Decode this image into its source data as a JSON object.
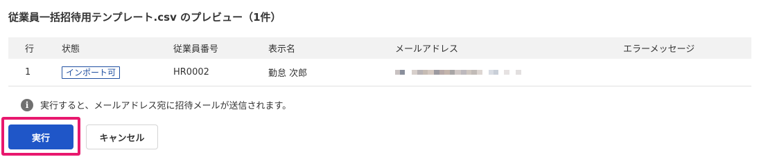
{
  "dialog": {
    "title": "従業員一括招待用テンプレート.csv のプレビュー（1件）"
  },
  "table": {
    "headers": {
      "row_no": "行",
      "status": "状態",
      "employee_no": "従業員番号",
      "display_name": "表示名",
      "email": "メールアドレス",
      "error_message": "エラーメッセージ"
    },
    "rows": [
      {
        "row_no": "1",
        "status": "インポート可",
        "employee_no": "HR0002",
        "display_name": "勤怠 次郎",
        "email": "",
        "error_message": ""
      }
    ]
  },
  "notice": {
    "text": "実行すると、メールアドレス宛に招待メールが送信されます。",
    "icon": "info-icon"
  },
  "actions": {
    "run_label": "実行",
    "cancel_label": "キャンセル"
  },
  "colors": {
    "primary": "#1f56c8",
    "badge": "#1f4fa0",
    "highlight": "#e8186e",
    "header_bg": "#f2f2f2"
  }
}
